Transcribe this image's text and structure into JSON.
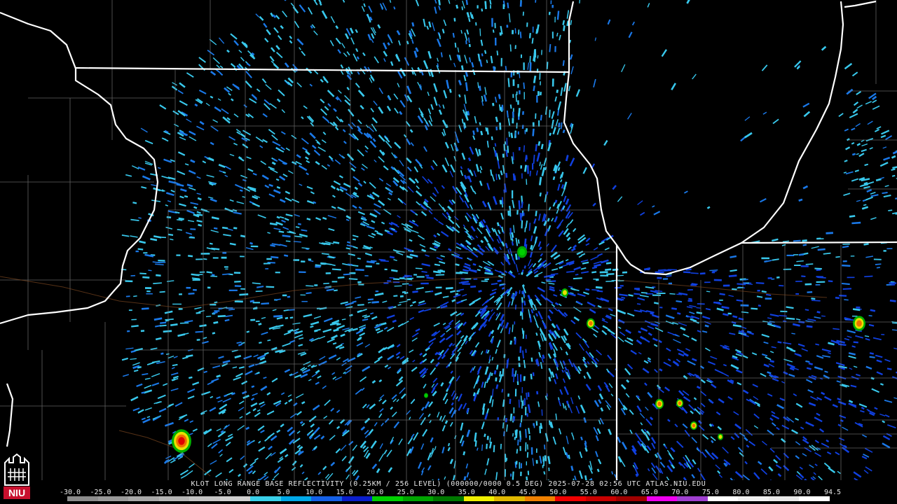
{
  "title": "KLOT LONG RANGE BASE REFLECTIVITY (0.25KM / 256 LEVEL) (000000/0000 0.5 DEG) 2025-07-28 02:56 UTC  ATLAS.NIU.EDU",
  "logo_text": "NIU",
  "legend": {
    "labels": [
      "-30.0",
      "-25.0",
      "-20.0",
      "-15.0",
      "-10.0",
      "-5.0",
      "0.0",
      "5.0",
      "10.0",
      "15.0",
      "20.0",
      "25.0",
      "30.0",
      "35.0",
      "40.0",
      "45.0",
      "50.0",
      "55.0",
      "60.0",
      "65.0",
      "70.0",
      "75.0",
      "80.0",
      "85.0",
      "90.0",
      "94.5"
    ],
    "colors": [
      "#8c8c8c",
      "#9a9a9a",
      "#a8a8a8",
      "#b5b5b5",
      "#c4c4c4",
      "#d0d0d0",
      "#3ad0ea",
      "#00a8e8",
      "#1460e8",
      "#0a1ecc",
      "#00d000",
      "#00a400",
      "#007800",
      "#f0f000",
      "#e0b800",
      "#f08000",
      "#f00000",
      "#c80000",
      "#a00000",
      "#f000f0",
      "#a040d0",
      "#ffffff",
      "#f0f0f0",
      "#e8e8e8",
      "#ffffff"
    ]
  },
  "colors": {
    "background": "#000000",
    "state_border": "#ffffff",
    "county_border": "#7a7a7a",
    "echo_light": "#38c8ec",
    "echo_mid": "#1a78e8",
    "echo_strong": "#1040e0"
  }
}
